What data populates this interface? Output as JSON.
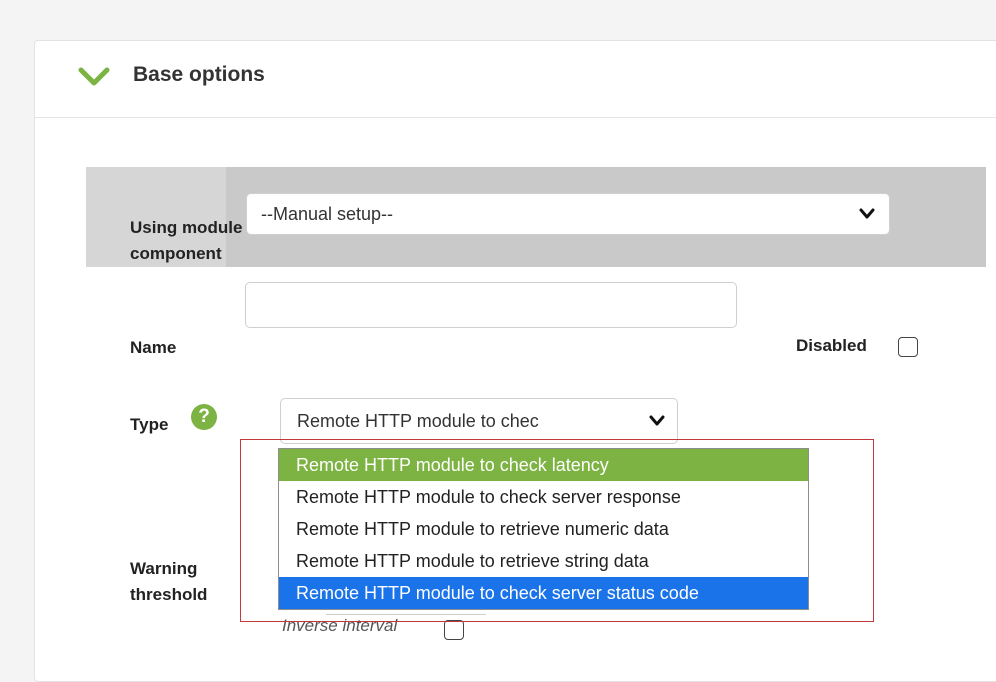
{
  "section": {
    "title": "Base options"
  },
  "form": {
    "module_component_label": "Using module component",
    "module_component_value": "--Manual setup--",
    "name_label": "Name",
    "name_value": "",
    "disabled_label": "Disabled",
    "type_label": "Type",
    "type_value": "Remote HTTP module to chec",
    "warning_label": "Warning threshold",
    "inverse_label": "Inverse interval"
  },
  "dropdown": {
    "options": [
      "Remote HTTP module to check latency",
      "Remote HTTP module to check server response",
      "Remote HTTP module to retrieve numeric data",
      "Remote HTTP module to retrieve string data",
      "Remote HTTP module to check server status code"
    ]
  },
  "colors": {
    "accent": "#7cb342",
    "highlight": "#1a73e8",
    "frame": "#c0393b"
  },
  "icons": {
    "expand": "chevron-down-icon",
    "help": "help-icon",
    "select_caret": "chevron-down-icon"
  }
}
